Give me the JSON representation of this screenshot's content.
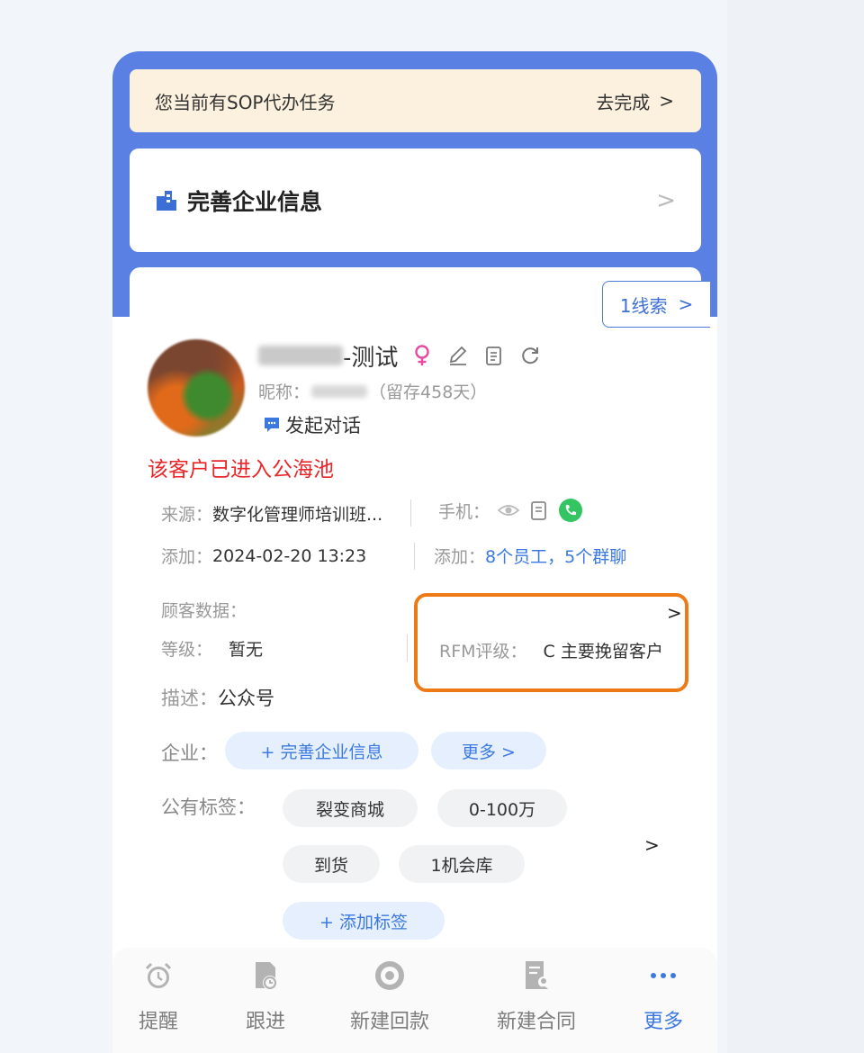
{
  "sop_banner": {
    "text": "您当前有SOP代办任务",
    "action": "去完成",
    "chevron": ">"
  },
  "enterprise_card": {
    "icon": "building-icon",
    "title": "完善企业信息",
    "chevron": ">"
  },
  "lead_button": {
    "label": "1线索",
    "chevron": ">"
  },
  "customer": {
    "name_suffix": "-测试",
    "nickname_label": "昵称：",
    "retention": "（留存458天）",
    "gender_icon": "female-icon",
    "chat_label": "发起对话",
    "public_pool_alert": "该客户已进入公海池"
  },
  "info": {
    "source_label": "来源：",
    "source_value": "数字化管理师培训班...",
    "phone_label": "手机：",
    "added_label": "添加：",
    "added_value": "2024-02-20 13:23",
    "added2_label": "添加：",
    "added2_value": "8个员工，5个群聊"
  },
  "customer_data": {
    "label": "顾客数据：",
    "grade_label": "等级：",
    "grade_value": "暂无",
    "rfm_label": "RFM评级：",
    "rfm_value": "C 主要挽留客户",
    "chevron": ">",
    "desc_label": "描述：",
    "desc_value": "公众号"
  },
  "enterprise_row": {
    "label": "企业：",
    "complete_button": "+ 完善企业信息",
    "more_button": "更多 >"
  },
  "tags": {
    "label": "公有标签：",
    "items": [
      "裂变商城",
      "0-100万",
      "到货",
      "1机会库"
    ],
    "chevron": ">",
    "add_button": "+ 添加标签"
  },
  "bottom_nav": [
    {
      "label": "提醒",
      "icon": "alarm-clock-icon"
    },
    {
      "label": "跟进",
      "icon": "followup-icon"
    },
    {
      "label": "新建回款",
      "icon": "payment-icon"
    },
    {
      "label": "新建合同",
      "icon": "contract-icon"
    },
    {
      "label": "更多",
      "icon": "more-dots-icon",
      "active": true
    }
  ],
  "colors": {
    "accent": "#3b79e0",
    "header_blue": "#5b80e4",
    "highlight": "#ee7a16",
    "alert": "#e8262a",
    "banner_bg": "#fcf0de"
  }
}
